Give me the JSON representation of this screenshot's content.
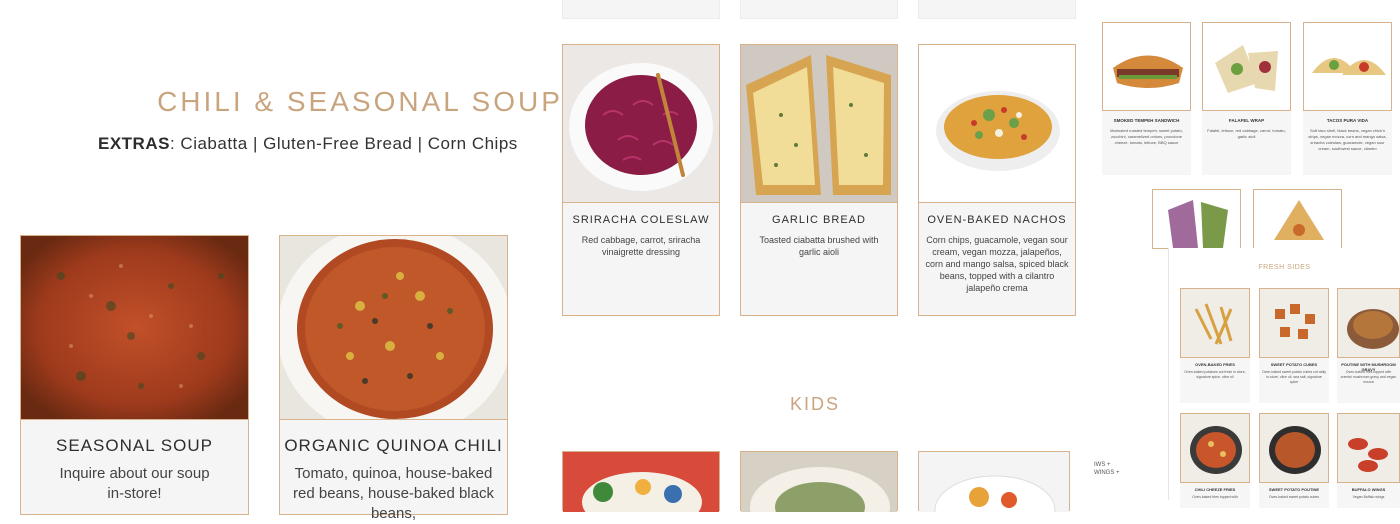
{
  "soup_section": {
    "title": "Chili & Seasonal Soup",
    "extras_label": "EXTRAS",
    "extras_text": ": Ciabatta | Gluten-Free Bread | Corn Chips"
  },
  "soup_cards": [
    {
      "name": "Seasonal Soup",
      "desc": "Inquire about our soup in-store!"
    },
    {
      "name": "Organic Quinoa Chili",
      "desc": "Tomato, quinoa, house-baked red beans, house-baked black beans,"
    }
  ],
  "side_cards": [
    {
      "name": "Sriracha Coleslaw",
      "desc": "Red cabbage, carrot, sriracha vinaigrette dressing"
    },
    {
      "name": "Garlic Bread",
      "desc": "Toasted ciabatta brushed with garlic aioli"
    },
    {
      "name": "Oven-Baked Nachos",
      "desc": "Corn chips, guacamole, vegan sour cream, vegan mozza, jalapeños, corn and mango salsa, spiced black beans, topped with a cilantro jalapeño crema"
    }
  ],
  "kids_title": "Kids",
  "mini_page": {
    "items": [
      {
        "name": "Smoked Tempeh Sandwich",
        "desc": "Marinated roasted tempeh, sweet potato, zucchini, caramelized onions, provolone cheeze, tomato, lettuce, BBQ sauce"
      },
      {
        "name": "Falafel Wrap",
        "desc": "Falafel, lettuce, red cabbage, carrot, tomato, garlic aioli"
      },
      {
        "name": "Tacos Pura Vida",
        "desc": "Soft taco shell, black beans, vegan chick'n strips, vegan mozza, corn and mango salsa, sriracha coleslaw, guacamole, vegan sour cream, southwest sauce, cilantro"
      }
    ],
    "fresh_sides_title": "Fresh Sides",
    "sides": [
      {
        "name": "Oven-Baked Fries",
        "desc": "Oven-baked potatoes cut fresh in store, signature spice, olive oil"
      },
      {
        "name": "Sweet Potato Cubes",
        "desc": "Oven-baked sweet potato cubes cut daily in-store, olive oil, sea salt, signature spice"
      },
      {
        "name": "Poutine with Mushroom Gravy",
        "desc": "Oven-baked fries topped with cremini mushroom gravy and vegan mozza"
      },
      {
        "name": "Chili Cheeze Fries",
        "desc": "Oven-baked fries topped with"
      },
      {
        "name": "Sweet Potato Poutine",
        "desc": "Oven-baked sweet potato cubes"
      },
      {
        "name": "Buffalo Wings",
        "desc": "Vegan Buffalo wings"
      }
    ],
    "left_fragments": [
      "IWS +",
      "WINGS +"
    ]
  },
  "colors": {
    "accent": "#c9a57f",
    "card_border": "#d8b28c",
    "card_bg": "#f6f5f5"
  }
}
